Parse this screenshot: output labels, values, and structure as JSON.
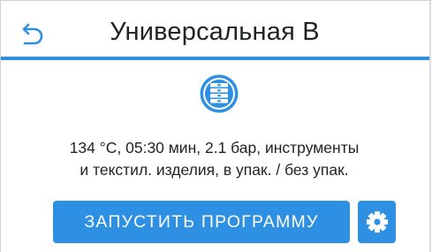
{
  "header": {
    "back_icon": "back-arrow-icon",
    "title": "Универсальная B"
  },
  "program": {
    "icon": "instrument-tray-stack-icon",
    "description_line1": "134 °C, 05:30 мин, 2.1 бар, инструменты",
    "description_line2": "и текстил. изделия, в упак. / без упак."
  },
  "actions": {
    "start_label": "ЗАПУСТИТЬ ПРОГРАММУ",
    "settings_icon": "gear-icon"
  },
  "colors": {
    "accent": "#2e90e3",
    "text": "#1f2326",
    "background": "#ffffff"
  }
}
